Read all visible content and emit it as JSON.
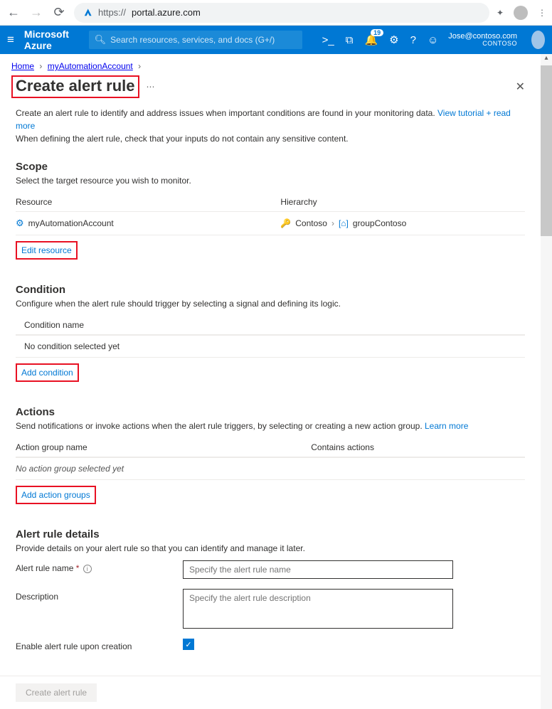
{
  "browser": {
    "url_scheme": "https://",
    "url_host": "portal.azure.com"
  },
  "header": {
    "brand": "Microsoft Azure",
    "search_placeholder": "Search resources, services, and docs (G+/)",
    "notification_count": "19",
    "user_email": "Jose@contoso.com",
    "tenant": "CONTOSO"
  },
  "breadcrumb": {
    "items": [
      "Home",
      "myAutomationAccount"
    ]
  },
  "page": {
    "title": "Create alert rule",
    "intro_line1": "Create an alert rule to identify and address issues when important conditions are found in your monitoring data. ",
    "intro_link": "View tutorial + read more",
    "intro_line2": "When defining the alert rule, check that your inputs do not contain any sensitive content."
  },
  "scope": {
    "title": "Scope",
    "desc": "Select the target resource you wish to monitor.",
    "col_a": "Resource",
    "col_b": "Hierarchy",
    "resource_name": "myAutomationAccount",
    "hierarchy_a": "Contoso",
    "hierarchy_b": "groupContoso",
    "edit_link": "Edit resource"
  },
  "condition": {
    "title": "Condition",
    "desc": "Configure when the alert rule should trigger by selecting a signal and defining its logic.",
    "col_a": "Condition name",
    "empty": "No condition selected yet",
    "add_link": "Add condition"
  },
  "actions": {
    "title": "Actions",
    "desc_pre": "Send notifications or invoke actions when the alert rule triggers, by selecting or creating a new action group. ",
    "learn_more": "Learn more",
    "col_a": "Action group name",
    "col_b": "Contains actions",
    "empty": "No action group selected yet",
    "add_link": "Add action groups"
  },
  "details": {
    "title": "Alert rule details",
    "desc": "Provide details on your alert rule so that you can identify and manage it later.",
    "name_label": "Alert rule name ",
    "name_placeholder": "Specify the alert rule name",
    "desc_label": "Description",
    "desc_placeholder": "Specify the alert rule description",
    "enable_label": "Enable alert rule upon creation"
  },
  "footer": {
    "create_button": "Create alert rule"
  }
}
